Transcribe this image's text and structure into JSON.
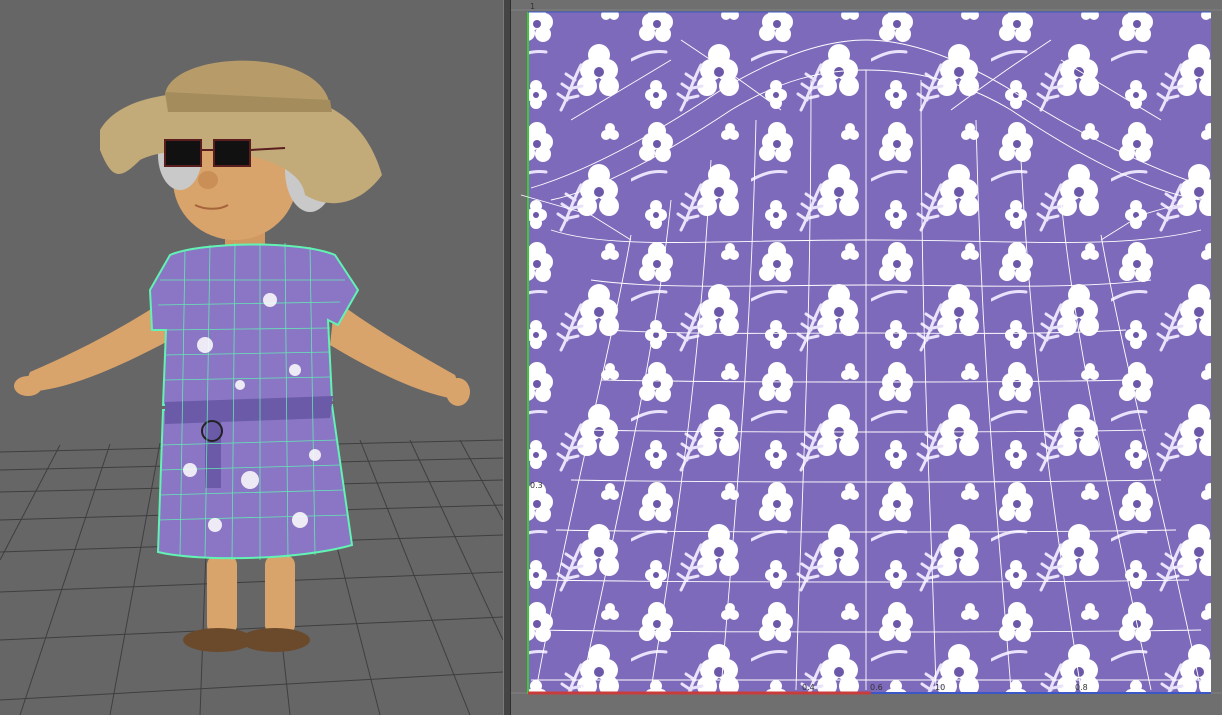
{
  "viewport": {
    "background_color": "#666666",
    "grid_color": "#3f3f3f",
    "mesh_wire_color": "#62f2b4",
    "dress_color": "#8a76c4",
    "character": {
      "hat": "sun-hat",
      "accessory": "sunglasses",
      "footwear": "sandals"
    }
  },
  "uv_editor": {
    "background_color": "#6f6f6f",
    "texture_color": "#7e6aba",
    "flower_color": "#ffffff",
    "wire_color": "#ffffff",
    "u_axis_color": "#c83c3c",
    "v_axis_color": "#3cc83c",
    "axis_labels": {
      "v_top": "1",
      "v_mid": "0.3",
      "u_a": "0.4",
      "u_b": "0.6",
      "u_c": "10",
      "u_d": "0.8"
    }
  }
}
